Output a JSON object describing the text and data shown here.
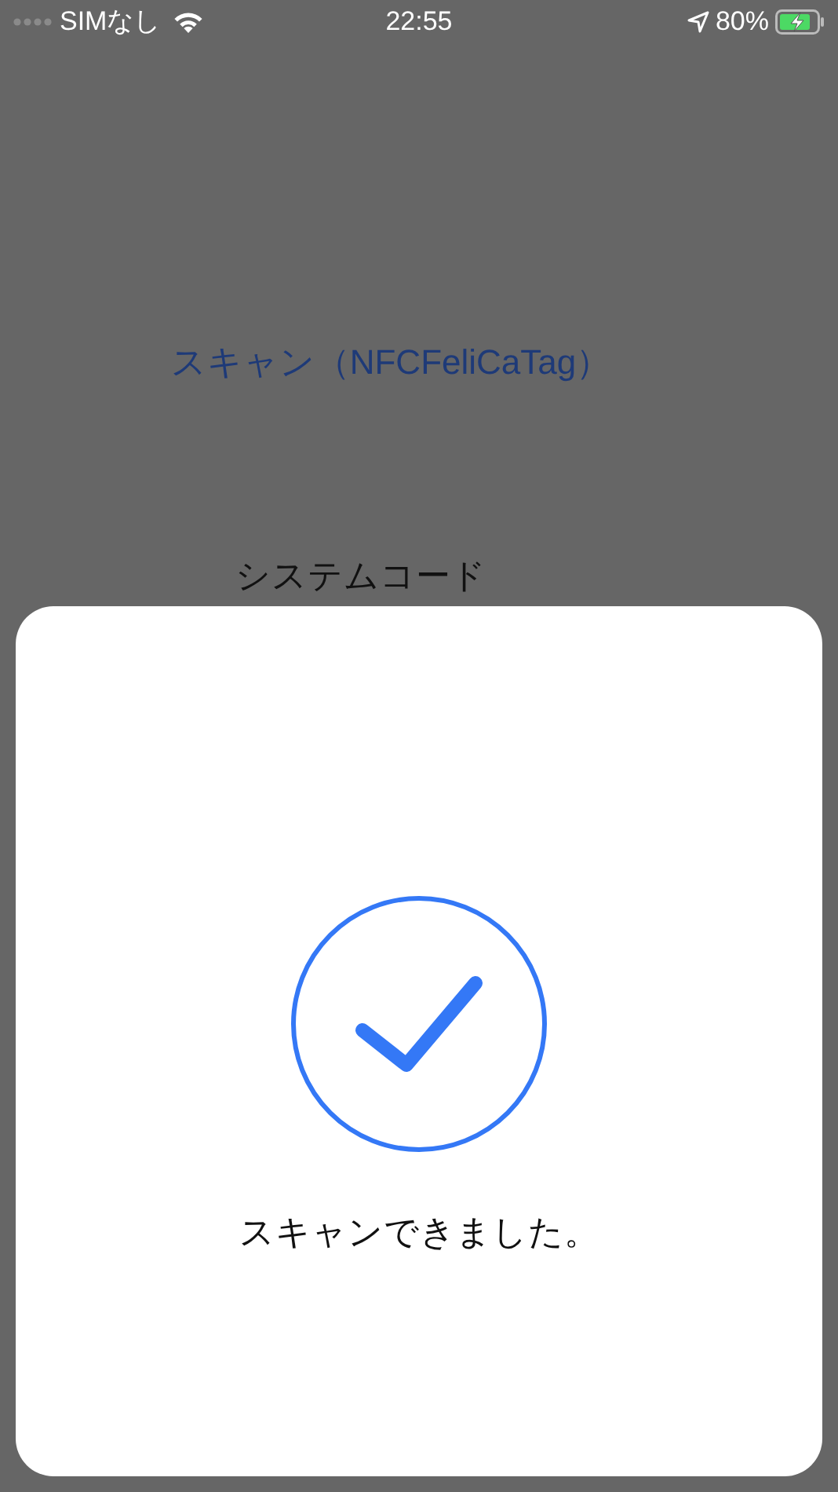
{
  "status_bar": {
    "carrier": "SIMなし",
    "time": "22:55",
    "battery": "80%"
  },
  "background": {
    "scan_link": "スキャン（NFCFeliCaTag）",
    "section_label": "システムコード"
  },
  "sheet": {
    "message": "スキャンできました。"
  }
}
